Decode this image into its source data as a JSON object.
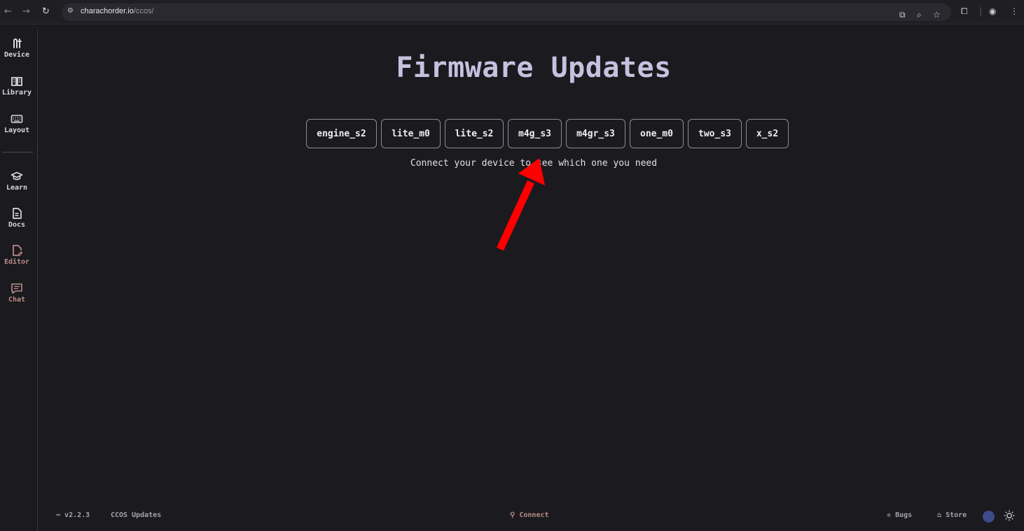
{
  "browser": {
    "url_host": "charachorder.io",
    "url_path": "/ccos/"
  },
  "sidebar": {
    "items": [
      {
        "label": "Device",
        "icon": "device-icon"
      },
      {
        "label": "Library",
        "icon": "book-icon"
      },
      {
        "label": "Layout",
        "icon": "keyboard-icon"
      },
      {
        "label": "Learn",
        "icon": "graduation-cap-icon"
      },
      {
        "label": "Docs",
        "icon": "document-icon"
      },
      {
        "label": "Editor",
        "icon": "edit-document-icon"
      },
      {
        "label": "Chat",
        "icon": "chat-icon"
      }
    ]
  },
  "main": {
    "title": "Firmware Updates",
    "firmware_options": [
      "engine_s2",
      "lite_m0",
      "lite_s2",
      "m4g_s3",
      "m4gr_s3",
      "one_m0",
      "two_s3",
      "x_s2"
    ],
    "hint": "Connect your device to see which one you need"
  },
  "footer": {
    "version": "v2.2.3",
    "updates_link": "CCOS Updates",
    "connect": "Connect",
    "bugs": "Bugs",
    "store": "Store"
  },
  "colors": {
    "background": "#1b1a1f",
    "title": "#c5c2e0",
    "accent_dim": "#b98d87",
    "annotation_arrow": "#ff0000"
  }
}
